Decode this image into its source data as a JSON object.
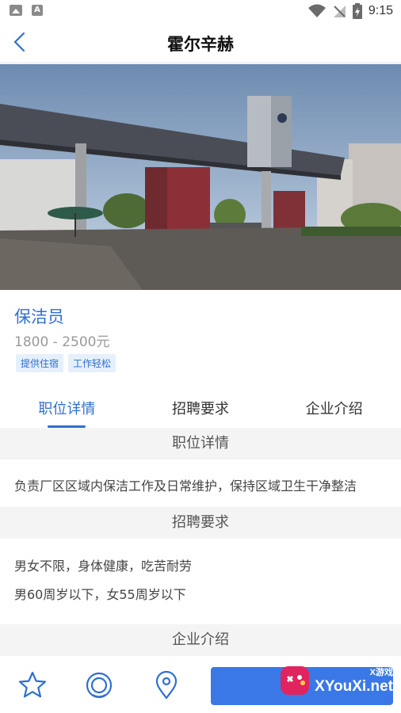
{
  "status_bar": {
    "time": "9:15"
  },
  "header": {
    "title": "霍尔辛赫",
    "back_icon": "chevron-left-icon"
  },
  "job": {
    "title": "保洁员",
    "salary": "1800 - 2500元",
    "tags": [
      "提供住宿",
      "工作轻松"
    ]
  },
  "tabs": [
    {
      "label": "职位详情",
      "active": true
    },
    {
      "label": "招聘要求",
      "active": false
    },
    {
      "label": "企业介绍",
      "active": false
    }
  ],
  "sections": {
    "details": {
      "heading": "职位详情",
      "text": "负责厂区区域内保洁工作及日常维护，保持区域卫生干净整洁"
    },
    "requirements": {
      "heading": "招聘要求",
      "lines": [
        "男女不限，身体健康，吃苦耐劳",
        "男60周岁以下，女55周岁以下"
      ]
    },
    "company": {
      "heading": "企业介绍"
    }
  },
  "bottom_bar": {
    "icons": [
      "star-icon",
      "chat-icon",
      "location-icon"
    ],
    "apply_button_label": "",
    "watermark": {
      "small": "X游戏",
      "large": "XYouXi.net"
    }
  },
  "colors": {
    "accent": "#2f6fd0",
    "button": "#3a78e8",
    "section_bg": "#f4f4f4"
  }
}
